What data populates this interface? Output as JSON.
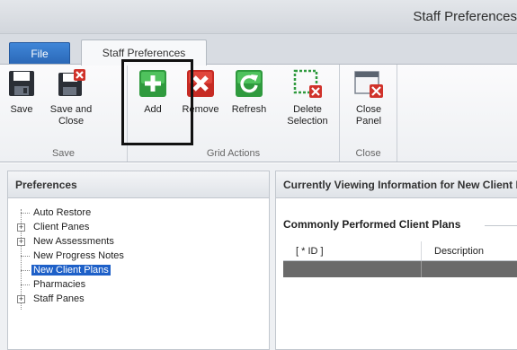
{
  "window": {
    "title": "Staff Preferences"
  },
  "tabs": {
    "file": "File",
    "staff_preferences": "Staff Preferences"
  },
  "ribbon": {
    "groups": [
      {
        "label": "Save",
        "buttons": [
          {
            "label": "Save"
          },
          {
            "label": "Save and\nClose"
          }
        ]
      },
      {
        "label": "Grid Actions",
        "buttons": [
          {
            "label": "Add"
          },
          {
            "label": "Remove"
          },
          {
            "label": "Refresh"
          },
          {
            "label": "Delete\nSelection"
          }
        ]
      },
      {
        "label": "Close",
        "buttons": [
          {
            "label": "Close\nPanel"
          }
        ]
      }
    ]
  },
  "preferences": {
    "header": "Preferences",
    "items": [
      {
        "label": "Auto Restore",
        "expandable": false,
        "selected": false
      },
      {
        "label": "Client Panes",
        "expandable": true,
        "selected": false
      },
      {
        "label": "New Assessments",
        "expandable": true,
        "selected": false
      },
      {
        "label": "New Progress Notes",
        "expandable": false,
        "selected": false
      },
      {
        "label": "New Client Plans",
        "expandable": false,
        "selected": true
      },
      {
        "label": "Pharmacies",
        "expandable": false,
        "selected": false
      },
      {
        "label": "Staff Panes",
        "expandable": true,
        "selected": false
      }
    ]
  },
  "details": {
    "header": "Currently Viewing Information for New Client Plans",
    "section_title": "Commonly Performed Client Plans",
    "grid": {
      "columns": [
        "[ * ID ]",
        "Description"
      ]
    }
  },
  "colors": {
    "file_tab": "#2a67b6",
    "selection": "#1e60c8",
    "grid_row": "#6a6a6a"
  }
}
